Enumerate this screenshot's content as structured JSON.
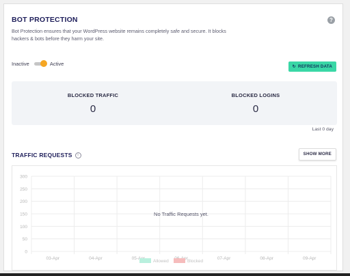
{
  "bot_protection": {
    "title": "BOT PROTECTION",
    "description": "Bot Protection ensures that your WordPress website remains completely safe and secure. It blocks hackers & bots before they harm your site.",
    "toggle": {
      "inactive_label": "Inactive",
      "active_label": "Active",
      "state": "active"
    },
    "refresh_label": "REFRESH DATA",
    "help_icon": "question-circle-icon"
  },
  "stats": {
    "blocked_traffic": {
      "label": "BLOCKED TRAFFIC",
      "value": "0"
    },
    "blocked_logins": {
      "label": "BLOCKED LOGINS",
      "value": "0"
    },
    "period": "Last 0 day"
  },
  "traffic": {
    "title": "TRAFFIC REQUESTS",
    "info_icon": "info-circle-icon",
    "show_more_label": "SHOW MORE",
    "empty_message": "No Traffic Requests yet."
  },
  "chart_data": {
    "type": "bar",
    "categories": [
      "03-Apr",
      "04-Apr",
      "05-Apr",
      "06-Apr",
      "07-Apr",
      "08-Apr",
      "09-Apr"
    ],
    "series": [
      {
        "name": "Allowed",
        "color": "#b9f0de",
        "values": [
          0,
          0,
          0,
          0,
          0,
          0,
          0
        ]
      },
      {
        "name": "Blocked",
        "color": "#f6bcbc",
        "values": [
          0,
          0,
          0,
          0,
          0,
          0,
          0
        ]
      }
    ],
    "y_ticks": [
      "300",
      "250",
      "200",
      "150",
      "100",
      "50",
      "0"
    ],
    "ylim": [
      0,
      300
    ],
    "grid": true,
    "legend": "bottom"
  },
  "colors": {
    "accent": "#3ad7a6",
    "toggle_knob": "#f5a623",
    "heading": "#1e1e5a"
  }
}
